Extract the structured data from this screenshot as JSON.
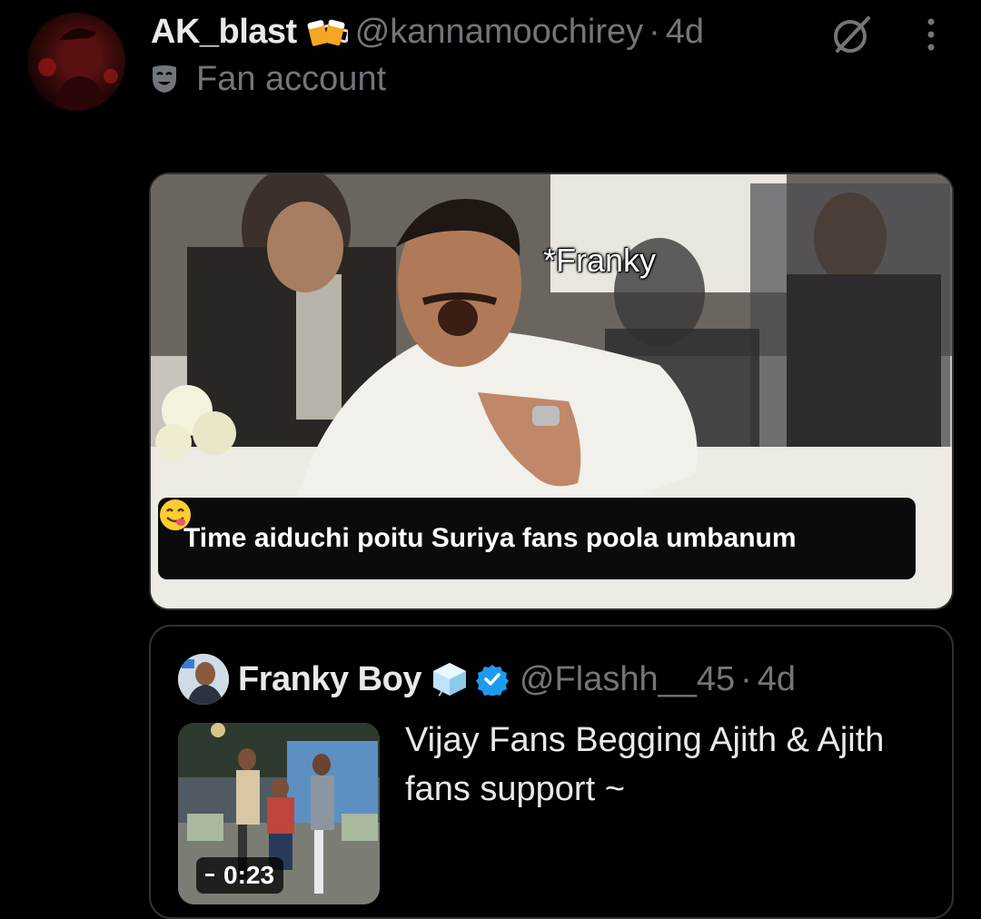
{
  "tweet": {
    "display_name": "AK_blast",
    "handle": "@kannamoochirey",
    "separator": "·",
    "time": "4d",
    "label": "Fan account",
    "icons": {
      "name_emoji": "beer-mugs-icon",
      "label_icon": "theater-mask-icon",
      "grok": "grok-icon",
      "more": "more-vertical-icon"
    }
  },
  "media": {
    "overlay_tag": "*Franky",
    "caption": "Time aiduchi poitu Suriya fans poola umbanum",
    "caption_emoji": "yum-face-icon"
  },
  "quote": {
    "display_name": "Franky Boy",
    "handle": "@Flashh__45",
    "separator": "·",
    "time": "4d",
    "text": "Vijay Fans Begging Ajith & Ajith fans support ~",
    "video_duration": "0:23",
    "icons": {
      "name_emoji": "ice-cube-icon",
      "badge": "verified-badge-icon"
    }
  },
  "colors": {
    "background": "#000000",
    "primary_text": "#e7e9ea",
    "secondary_text": "#71767b",
    "border": "#2f3336",
    "verified": "#1d9bf0"
  }
}
